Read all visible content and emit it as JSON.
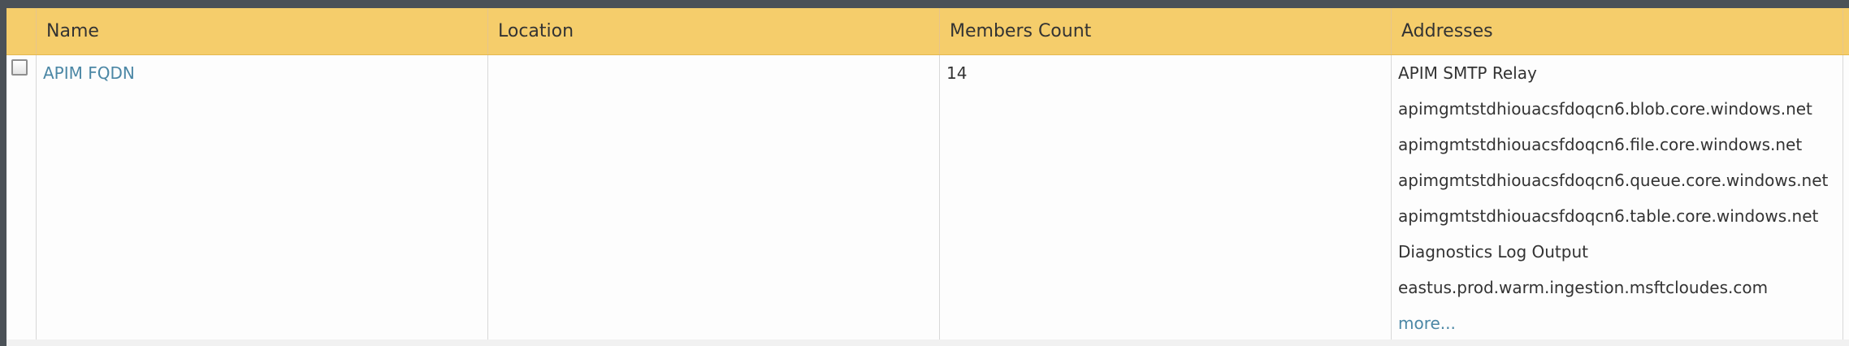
{
  "table": {
    "columns": {
      "name": "Name",
      "location": "Location",
      "members_count": "Members Count",
      "addresses": "Addresses"
    },
    "rows": [
      {
        "checked": false,
        "name": "APIM FQDN",
        "location": "",
        "members_count": "14",
        "addresses": [
          "APIM SMTP Relay",
          "apimgmtstdhiouacsfdoqcn6.blob.core.windows.net",
          "apimgmtstdhiouacsfdoqcn6.file.core.windows.net",
          "apimgmtstdhiouacsfdoqcn6.queue.core.windows.net",
          "apimgmtstdhiouacsfdoqcn6.table.core.windows.net",
          "Diagnostics Log Output",
          "eastus.prod.warm.ingestion.msftcloudes.com"
        ],
        "more_label": "more..."
      }
    ]
  },
  "colors": {
    "header_background": "#f5cd6b",
    "link": "#4b87a5",
    "frame": "#4b5157"
  }
}
